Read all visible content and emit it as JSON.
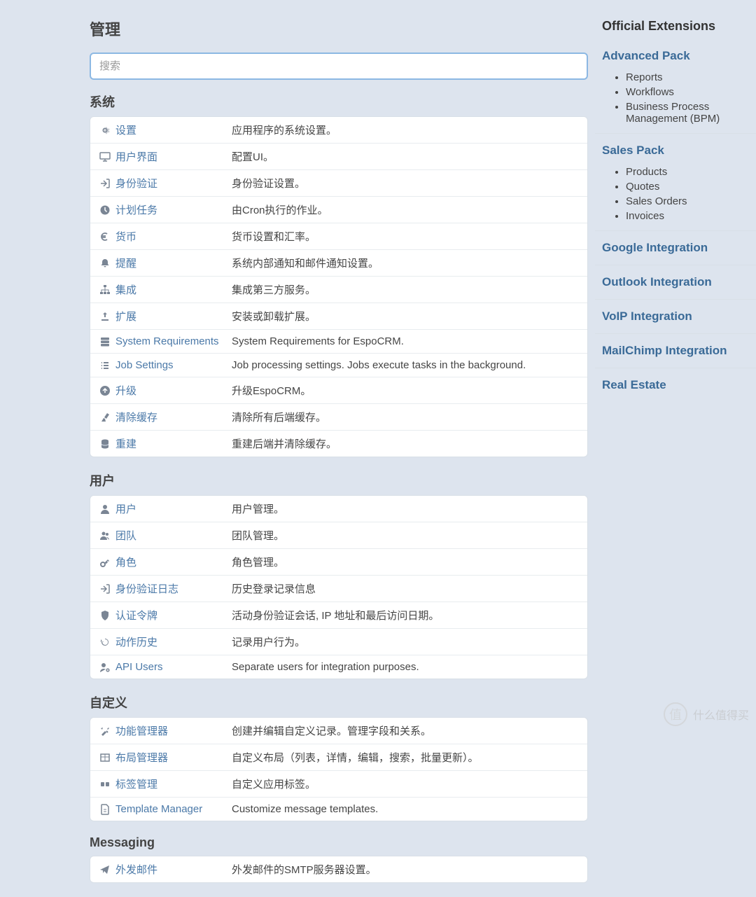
{
  "page_title": "管理",
  "search": {
    "placeholder": "搜索"
  },
  "sections": [
    {
      "title": "系统",
      "items": [
        {
          "icon": "gear",
          "label": "设置",
          "desc": "应用程序的系统设置。"
        },
        {
          "icon": "monitor",
          "label": "用户界面",
          "desc": "配置UI。"
        },
        {
          "icon": "login",
          "label": "身份验证",
          "desc": "身份验证设置。"
        },
        {
          "icon": "clock",
          "label": "计划任务",
          "desc": "由Cron执行的作业。"
        },
        {
          "icon": "euro",
          "label": "货币",
          "desc": "货币设置和汇率。"
        },
        {
          "icon": "bell",
          "label": "提醒",
          "desc": "系统内部通知和邮件通知设置。"
        },
        {
          "icon": "sitemap",
          "label": "集成",
          "desc": "集成第三方服务。"
        },
        {
          "icon": "upload",
          "label": "扩展",
          "desc": "安装或卸载扩展。"
        },
        {
          "icon": "server",
          "label": "System Requirements",
          "desc": "System Requirements for EspoCRM."
        },
        {
          "icon": "list",
          "label": "Job Settings",
          "desc": "Job processing settings. Jobs execute tasks in the background."
        },
        {
          "icon": "arrowup",
          "label": "升级",
          "desc": "升级EspoCRM。"
        },
        {
          "icon": "broom",
          "label": "清除缓存",
          "desc": "清除所有后端缓存。"
        },
        {
          "icon": "database",
          "label": "重建",
          "desc": "重建后端并清除缓存。"
        }
      ]
    },
    {
      "title": "用户",
      "items": [
        {
          "icon": "user",
          "label": "用户",
          "desc": "用户管理。"
        },
        {
          "icon": "users",
          "label": "团队",
          "desc": "团队管理。"
        },
        {
          "icon": "key",
          "label": "角色",
          "desc": "角色管理。"
        },
        {
          "icon": "login",
          "label": "身份验证日志",
          "desc": "历史登录记录信息"
        },
        {
          "icon": "shield",
          "label": "认证令牌",
          "desc": "活动身份验证会话, IP 地址和最后访问日期。"
        },
        {
          "icon": "history",
          "label": "动作历史",
          "desc": "记录用户行为。"
        },
        {
          "icon": "usergear",
          "label": "API Users",
          "desc": "Separate users for integration purposes."
        }
      ]
    },
    {
      "title": "自定义",
      "items": [
        {
          "icon": "tools",
          "label": "功能管理器",
          "desc": "创建并编辑自定义记录。管理字段和关系。"
        },
        {
          "icon": "table",
          "label": "布局管理器",
          "desc": "自定义布局（列表，详情，编辑，搜索，批量更新）。"
        },
        {
          "icon": "tag",
          "label": "标签管理",
          "desc": "自定义应用标签。"
        },
        {
          "icon": "filealt",
          "label": "Template Manager",
          "desc": "Customize message templates."
        }
      ]
    },
    {
      "title": "Messaging",
      "items": [
        {
          "icon": "send",
          "label": "外发邮件",
          "desc": "外发邮件的SMTP服务器设置。"
        }
      ]
    }
  ],
  "extensions": {
    "title": "Official Extensions",
    "groups": [
      {
        "name": "Advanced Pack",
        "items": [
          "Reports",
          "Workflows",
          "Business Process Management (BPM)"
        ]
      },
      {
        "name": "Sales Pack",
        "items": [
          "Products",
          "Quotes",
          "Sales Orders",
          "Invoices"
        ]
      },
      {
        "name": "Google Integration",
        "items": []
      },
      {
        "name": "Outlook Integration",
        "items": []
      },
      {
        "name": "VoIP Integration",
        "items": []
      },
      {
        "name": "MailChimp Integration",
        "items": []
      },
      {
        "name": "Real Estate",
        "items": []
      }
    ]
  },
  "watermark": {
    "text": "什么值得买"
  }
}
